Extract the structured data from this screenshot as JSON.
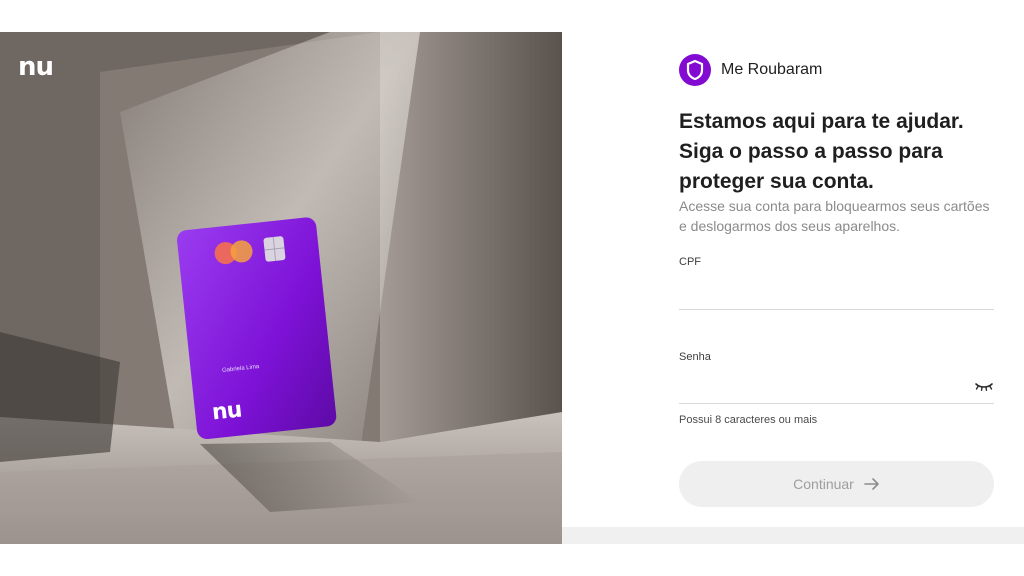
{
  "hero": {
    "logo": "nu",
    "card": {
      "holder_name": "Gabriela Lima",
      "logo": "nu",
      "color": "#820ad1"
    }
  },
  "brand": {
    "name": "Me Roubaram",
    "icon": "shield-icon",
    "color": "#820ad1"
  },
  "headline": {
    "line1": "Estamos aqui para te ajudar.",
    "line2": "Siga o passo a passo para",
    "line3": "proteger sua conta."
  },
  "subtext": "Acesse sua conta para bloquearmos seus cartões e deslogarmos dos seus aparelhos.",
  "form": {
    "cpf_label": "CPF",
    "cpf_value": "",
    "senha_label": "Senha",
    "senha_value": "",
    "senha_icon": "eye-closed-icon",
    "senha_hint": "Possui 8 caracteres ou mais",
    "submit_label": "Continuar",
    "submit_icon": "arrow-right-icon"
  }
}
